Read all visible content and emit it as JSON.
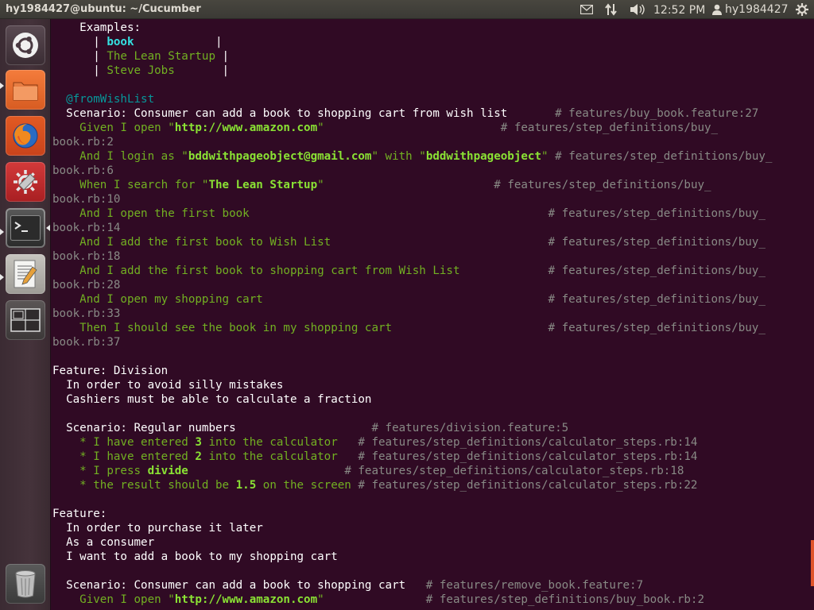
{
  "top_panel": {
    "window_title": "hy1984427@ubuntu: ~/Cucumber",
    "time": "12:52 PM",
    "user": "hy1984427",
    "icons": [
      "mail-icon",
      "network-icon",
      "sound-icon",
      "user-icon",
      "gear-icon"
    ]
  },
  "launcher": {
    "items": [
      {
        "name": "ubuntu-dash",
        "icon": "ubuntu-logo-icon"
      },
      {
        "name": "files",
        "icon": "folder-icon"
      },
      {
        "name": "firefox",
        "icon": "firefox-icon"
      },
      {
        "name": "system-settings",
        "icon": "settings-icon"
      },
      {
        "name": "terminal",
        "icon": "terminal-icon"
      },
      {
        "name": "text-editor",
        "icon": "text-editor-icon"
      },
      {
        "name": "workspace-switcher",
        "icon": "workspace-icon"
      },
      {
        "name": "trash",
        "icon": "trash-icon"
      }
    ]
  },
  "terminal": {
    "lines": [
      [
        {
          "t": "    Examples:",
          "c": "white"
        }
      ],
      [
        {
          "t": "      | ",
          "c": "white"
        },
        {
          "t": "book",
          "c": "cyan"
        },
        {
          "t": "            |",
          "c": "white"
        }
      ],
      [
        {
          "t": "      | ",
          "c": "white"
        },
        {
          "t": "The Lean Startup",
          "c": "ok"
        },
        {
          "t": " |",
          "c": "white"
        }
      ],
      [
        {
          "t": "      | ",
          "c": "white"
        },
        {
          "t": "Steve Jobs",
          "c": "ok"
        },
        {
          "t": "       |",
          "c": "white"
        }
      ],
      [
        {
          "t": "",
          "c": "white"
        }
      ],
      [
        {
          "t": "  @fromWishList",
          "c": "tag"
        }
      ],
      [
        {
          "t": "  Scenario: Consumer can add a book to shopping cart from wish list       ",
          "c": "white"
        },
        {
          "t": "# features/buy_book.feature:27",
          "c": "comment"
        }
      ],
      [
        {
          "t": "    Given I open \"",
          "c": "ok"
        },
        {
          "t": "http://www.amazon.com",
          "c": "greenb"
        },
        {
          "t": "\"                          ",
          "c": "ok"
        },
        {
          "t": "# features/step_definitions/buy_",
          "c": "comment"
        }
      ],
      [
        {
          "t": "book.rb:2",
          "c": "comment"
        }
      ],
      [
        {
          "t": "    And I login as \"",
          "c": "ok"
        },
        {
          "t": "bddwithpageobject@gmail.com",
          "c": "greenb"
        },
        {
          "t": "\" with \"",
          "c": "ok"
        },
        {
          "t": "bddwithpageobject",
          "c": "greenb"
        },
        {
          "t": "\" ",
          "c": "ok"
        },
        {
          "t": "# features/step_definitions/buy_",
          "c": "comment"
        }
      ],
      [
        {
          "t": "book.rb:6",
          "c": "comment"
        }
      ],
      [
        {
          "t": "    When I search for \"",
          "c": "ok"
        },
        {
          "t": "The Lean Startup",
          "c": "greenb"
        },
        {
          "t": "\"                         ",
          "c": "ok"
        },
        {
          "t": "# features/step_definitions/buy_",
          "c": "comment"
        }
      ],
      [
        {
          "t": "book.rb:10",
          "c": "comment"
        }
      ],
      [
        {
          "t": "    And I open the first book                                            ",
          "c": "ok"
        },
        {
          "t": "# features/step_definitions/buy_",
          "c": "comment"
        }
      ],
      [
        {
          "t": "book.rb:14",
          "c": "comment"
        }
      ],
      [
        {
          "t": "    And I add the first book to Wish List                                ",
          "c": "ok"
        },
        {
          "t": "# features/step_definitions/buy_",
          "c": "comment"
        }
      ],
      [
        {
          "t": "book.rb:18",
          "c": "comment"
        }
      ],
      [
        {
          "t": "    And I add the first book to shopping cart from Wish List             ",
          "c": "ok"
        },
        {
          "t": "# features/step_definitions/buy_",
          "c": "comment"
        }
      ],
      [
        {
          "t": "book.rb:28",
          "c": "comment"
        }
      ],
      [
        {
          "t": "    And I open my shopping cart                                          ",
          "c": "ok"
        },
        {
          "t": "# features/step_definitions/buy_",
          "c": "comment"
        }
      ],
      [
        {
          "t": "book.rb:33",
          "c": "comment"
        }
      ],
      [
        {
          "t": "    Then I should see the book in my shopping cart                       ",
          "c": "ok"
        },
        {
          "t": "# features/step_definitions/buy_",
          "c": "comment"
        }
      ],
      [
        {
          "t": "book.rb:37",
          "c": "comment"
        }
      ],
      [
        {
          "t": "",
          "c": "white"
        }
      ],
      [
        {
          "t": "Feature: Division",
          "c": "white"
        }
      ],
      [
        {
          "t": "  In order to avoid silly mistakes",
          "c": "white"
        }
      ],
      [
        {
          "t": "  Cashiers must be able to calculate a fraction",
          "c": "white"
        }
      ],
      [
        {
          "t": "",
          "c": "white"
        }
      ],
      [
        {
          "t": "  Scenario: Regular numbers                    ",
          "c": "white"
        },
        {
          "t": "# features/division.feature:5",
          "c": "comment"
        }
      ],
      [
        {
          "t": "    * I have entered ",
          "c": "ok"
        },
        {
          "t": "3",
          "c": "greenb"
        },
        {
          "t": " into the calculator   ",
          "c": "ok"
        },
        {
          "t": "# features/step_definitions/calculator_steps.rb:14",
          "c": "comment"
        }
      ],
      [
        {
          "t": "    * I have entered ",
          "c": "ok"
        },
        {
          "t": "2",
          "c": "greenb"
        },
        {
          "t": " into the calculator   ",
          "c": "ok"
        },
        {
          "t": "# features/step_definitions/calculator_steps.rb:14",
          "c": "comment"
        }
      ],
      [
        {
          "t": "    * I press ",
          "c": "ok"
        },
        {
          "t": "divide",
          "c": "greenb"
        },
        {
          "t": "                       ",
          "c": "ok"
        },
        {
          "t": "# features/step_definitions/calculator_steps.rb:18",
          "c": "comment"
        }
      ],
      [
        {
          "t": "    * the result should be ",
          "c": "ok"
        },
        {
          "t": "1.5",
          "c": "greenb"
        },
        {
          "t": " on the screen ",
          "c": "ok"
        },
        {
          "t": "# features/step_definitions/calculator_steps.rb:22",
          "c": "comment"
        }
      ],
      [
        {
          "t": "",
          "c": "white"
        }
      ],
      [
        {
          "t": "Feature:",
          "c": "white"
        }
      ],
      [
        {
          "t": "  In order to purchase it later",
          "c": "white"
        }
      ],
      [
        {
          "t": "  As a consumer",
          "c": "white"
        }
      ],
      [
        {
          "t": "  I want to add a book to my shopping cart",
          "c": "white"
        }
      ],
      [
        {
          "t": "",
          "c": "white"
        }
      ],
      [
        {
          "t": "  Scenario: Consumer can add a book to shopping cart   ",
          "c": "white"
        },
        {
          "t": "# features/remove_book.feature:7",
          "c": "comment"
        }
      ],
      [
        {
          "t": "    Given I open \"",
          "c": "ok"
        },
        {
          "t": "http://www.amazon.com",
          "c": "greenb"
        },
        {
          "t": "\"               ",
          "c": "ok"
        },
        {
          "t": "# features/step_definitions/buy_book.rb:2",
          "c": "comment"
        }
      ]
    ]
  },
  "colors": {
    "terminal_bg": "#300a24",
    "panel_bg": "#3c3b37",
    "step_pass": "#72b022",
    "param": "#8ae234",
    "comment": "#888a85",
    "tag": "#06989a",
    "outline_param": "#34e2e2",
    "scroll_accent": "#e0542a"
  }
}
